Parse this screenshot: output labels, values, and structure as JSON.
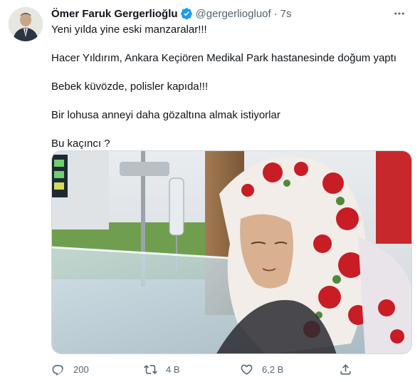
{
  "author": {
    "name": "Ömer Faruk Gergerlioğlu",
    "handle": "@gergerliogluof",
    "separator": "·",
    "time": "7s"
  },
  "tweet": {
    "lines": [
      "Yeni yılda yine eski manzaralar!!!",
      "Hacer Yıldırım, Ankara Keçiören Medikal Park hastanesinde doğum yaptı",
      "Bebek küvözde, polisler kapıda!!!",
      "Bir lohusa anneyi daha gözaltına almak istiyorlar",
      "Bu kaçıncı ?"
    ]
  },
  "actions": {
    "replies": "200",
    "retweets": "4 B",
    "likes": "6,2 B"
  },
  "icons": {
    "verified": "verified-badge-icon",
    "more": "more-dots-icon",
    "reply": "reply-icon",
    "retweet": "retweet-icon",
    "like": "heart-icon",
    "share": "share-icon"
  },
  "colors": {
    "text": "#0f1419",
    "secondary": "#536471",
    "verified": "#1d9bf0",
    "border": "#cfd9de"
  }
}
